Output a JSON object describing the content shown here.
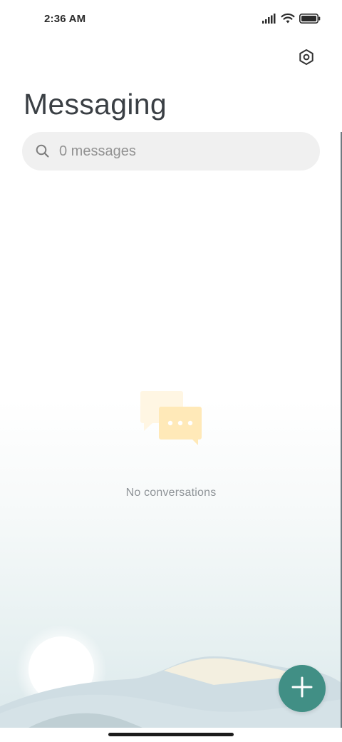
{
  "status_bar": {
    "time": "2:36 AM",
    "icons": [
      "signal-icon",
      "wifi-icon",
      "battery-icon"
    ]
  },
  "header": {
    "title": "Messaging",
    "settings_icon": "settings-hexagon-icon"
  },
  "search": {
    "placeholder": "0 messages",
    "icon": "search-icon"
  },
  "empty_state": {
    "illustration": "chat-bubbles-icon",
    "text": "No conversations"
  },
  "fab": {
    "icon": "plus-icon"
  },
  "colors": {
    "accent": "#418f85",
    "title": "#3a3f44",
    "search_bg": "#f0f0f0",
    "empty_text": "#8f9498"
  }
}
